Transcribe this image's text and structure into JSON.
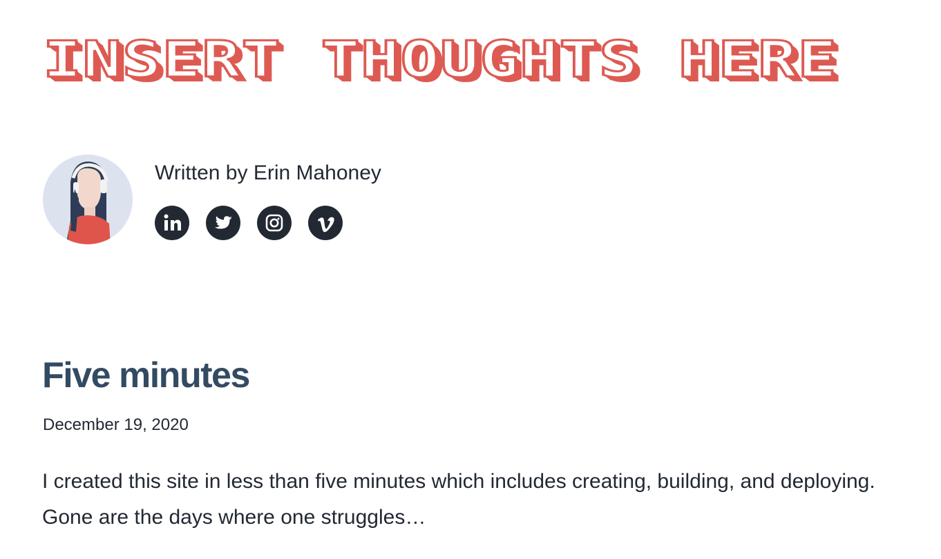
{
  "site": {
    "title": "INSERT THOUGHTS HERE"
  },
  "author": {
    "written_by": "Written by Erin Mahoney",
    "social_links": [
      {
        "icon": "linkedin-icon"
      },
      {
        "icon": "twitter-icon"
      },
      {
        "icon": "instagram-icon"
      },
      {
        "icon": "vimeo-icon"
      }
    ]
  },
  "post": {
    "title": "Five minutes",
    "date": "December 19, 2020",
    "excerpt": "I created this site in less than five minutes which includes creating, building, and deploying. Gone are the days where one struggles…"
  },
  "colors": {
    "title_accent": "#dd5a52",
    "post_title": "#334a63",
    "text": "#222933",
    "icon_bg": "#222933",
    "avatar_bg": "#dde3ee"
  }
}
